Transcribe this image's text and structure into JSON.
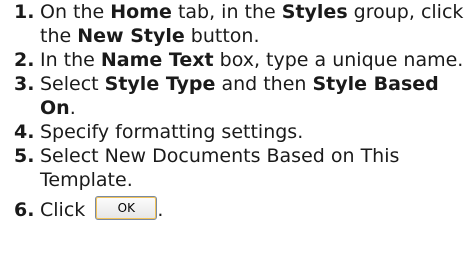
{
  "steps": [
    {
      "num": "1.",
      "parts": [
        {
          "t": "On the ",
          "b": false
        },
        {
          "t": "Home",
          "b": true
        },
        {
          "t": " tab, in the ",
          "b": false
        },
        {
          "t": "Styles",
          "b": true
        },
        {
          "t": " group, click the ",
          "b": false
        },
        {
          "t": "New Style",
          "b": true
        },
        {
          "t": " button.",
          "b": false
        }
      ]
    },
    {
      "num": "2.",
      "parts": [
        {
          "t": "In the ",
          "b": false
        },
        {
          "t": "Name Text",
          "b": true
        },
        {
          "t": " box, type a unique name.",
          "b": false
        }
      ]
    },
    {
      "num": "3.",
      "parts": [
        {
          "t": "Select ",
          "b": false
        },
        {
          "t": "Style Type",
          "b": true
        },
        {
          "t": " and then ",
          "b": false
        },
        {
          "t": "Style Based On",
          "b": true
        },
        {
          "t": ".",
          "b": false
        }
      ]
    },
    {
      "num": "4.",
      "parts": [
        {
          "t": "Specify formatting settings.",
          "b": false
        }
      ]
    },
    {
      "num": "5.",
      "parts": [
        {
          "t": "Select New Documents Based on This Template.",
          "b": false
        }
      ]
    },
    {
      "num": "6.",
      "parts": [
        {
          "t": "Click ",
          "b": false
        }
      ],
      "button": "OK",
      "after": "."
    }
  ]
}
